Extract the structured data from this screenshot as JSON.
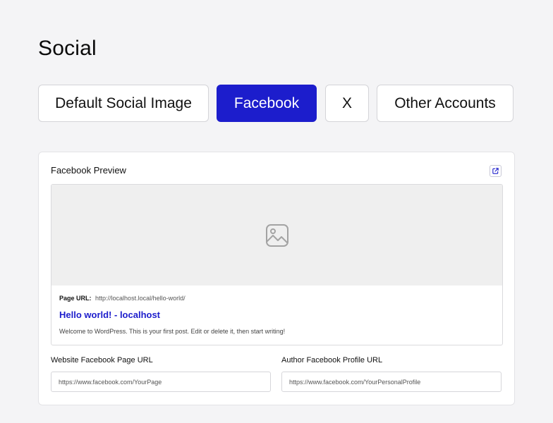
{
  "page": {
    "title": "Social"
  },
  "tabs": [
    {
      "label": "Default Social Image",
      "active": false
    },
    {
      "label": "Facebook",
      "active": true
    },
    {
      "label": "X",
      "active": false
    },
    {
      "label": "Other Accounts",
      "active": false
    }
  ],
  "colors": {
    "accent": "#1c1dcc",
    "background": "#f4f4f6",
    "card": "#ffffff"
  },
  "preview": {
    "title": "Facebook Preview",
    "external_link_icon": "external-link-icon",
    "image_icon": "image-placeholder-icon",
    "url_label": "Page URL:",
    "url": "http://localhost.local/hello-world/",
    "post_title": "Hello world! - localhost",
    "post_description": "Welcome to WordPress. This is your first post. Edit or delete it, then start writing!"
  },
  "fields": {
    "website_page": {
      "label": "Website Facebook Page URL",
      "placeholder": "https://www.facebook.com/YourPage",
      "value": ""
    },
    "author_profile": {
      "label": "Author Facebook Profile URL",
      "placeholder": "https://www.facebook.com/YourPersonalProfile",
      "value": ""
    }
  }
}
